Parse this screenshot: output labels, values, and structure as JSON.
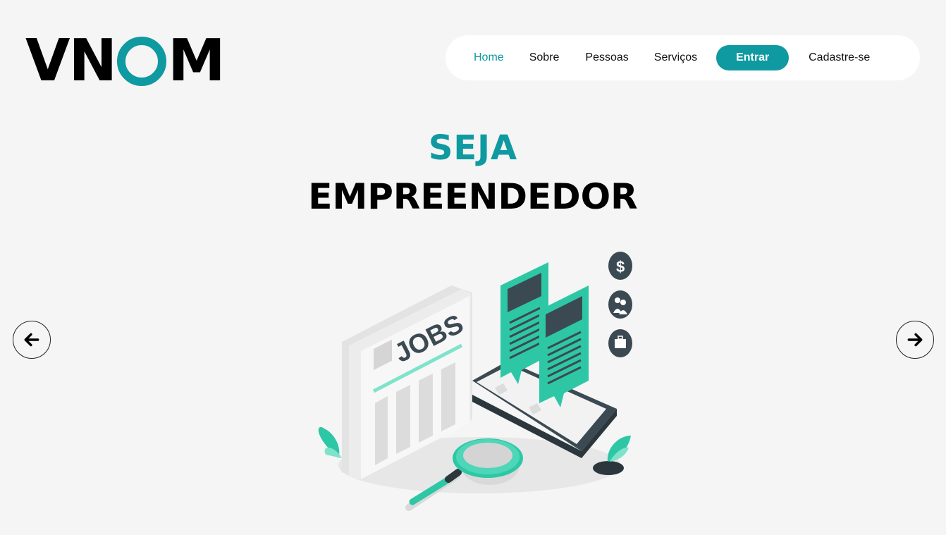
{
  "logo": {
    "part1": "VN",
    "part2": "M"
  },
  "nav": {
    "items": [
      "Home",
      "Sobre",
      "Pessoas",
      "Serviços"
    ],
    "login_button": "Entrar",
    "signup": "Cadastre-se"
  },
  "hero": {
    "line1": "SEJA",
    "line2": "EMPREENDEDOR",
    "illustration_text": "JOBS"
  },
  "carousel": {
    "prev_icon": "arrow-left-icon",
    "next_icon": "arrow-right-icon"
  },
  "colors": {
    "accent": "#0e9aa0",
    "illustration_green": "#2ec7a6",
    "background": "#f4f5f4"
  }
}
